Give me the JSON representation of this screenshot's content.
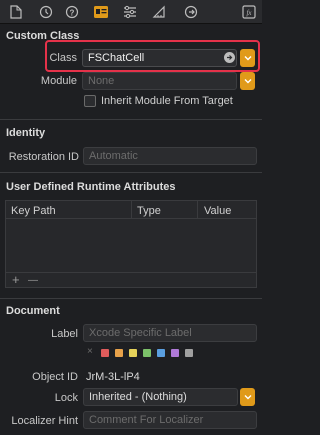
{
  "toolbar": {
    "icons": [
      "file-icon",
      "history-icon",
      "help-icon",
      "identity-icon",
      "attributes-icon",
      "ruler-icon",
      "connections-icon",
      "effects-icon"
    ]
  },
  "custom_class": {
    "title": "Custom Class",
    "class_label": "Class",
    "class_value": "FSChatCell",
    "module_label": "Module",
    "module_placeholder": "None",
    "inherit_label": "Inherit Module From Target"
  },
  "identity": {
    "title": "Identity",
    "restoration_label": "Restoration ID",
    "restoration_placeholder": "Automatic"
  },
  "runtime_attributes": {
    "title": "User Defined Runtime Attributes",
    "columns": [
      "Key Path",
      "Type",
      "Value"
    ],
    "add_label": "+",
    "remove_label": "—"
  },
  "document": {
    "title": "Document",
    "label_label": "Label",
    "label_placeholder": "Xcode Specific Label",
    "clear_label": "×",
    "swatch_colors": [
      "#e05c5c",
      "#e8a24a",
      "#e6d25a",
      "#7cc26a",
      "#5a9fe0",
      "#b07ad8",
      "#a0a0a0"
    ],
    "object_id_label": "Object ID",
    "object_id_value": "JrM-3L-lP4",
    "lock_label": "Lock",
    "lock_value": "Inherited - (Nothing)",
    "localizer_label": "Localizer Hint",
    "localizer_placeholder": "Comment For Localizer"
  },
  "colors": {
    "accent_orange": "#e09a1a",
    "highlight_red": "#e5324a"
  }
}
